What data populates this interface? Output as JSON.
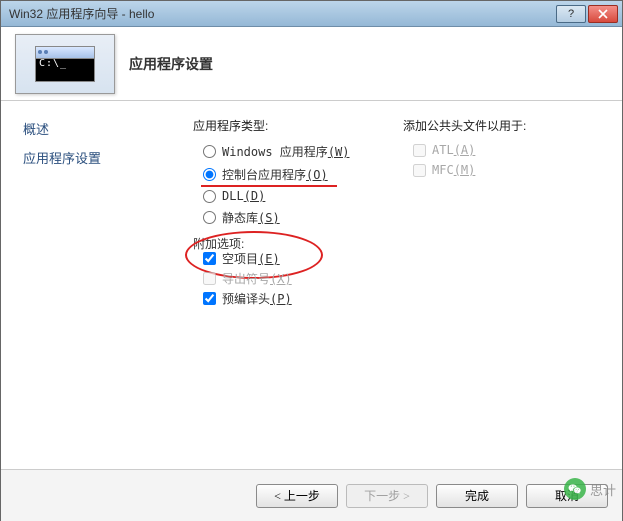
{
  "title": "Win32 应用程序向导 - hello",
  "header_title": "应用程序设置",
  "thumb_prompt": "C:\\_",
  "sidebar": {
    "items": [
      {
        "label": "概述"
      },
      {
        "label": "应用程序设置"
      }
    ]
  },
  "app_type": {
    "label": "应用程序类型:",
    "options": [
      {
        "text": "Windows 应用程序",
        "accel": "(W)",
        "checked": false
      },
      {
        "text": "控制台应用程序",
        "accel": "(O)",
        "checked": true
      },
      {
        "text": "DLL",
        "accel": "(D)",
        "checked": false
      },
      {
        "text": "静态库",
        "accel": "(S)",
        "checked": false
      }
    ]
  },
  "extra_opts": {
    "label": "附加选项:",
    "options": [
      {
        "text": "空项目",
        "accel": "(E)",
        "checked": true,
        "disabled": false
      },
      {
        "text": "导出符号",
        "accel": "(X)",
        "checked": false,
        "disabled": true
      },
      {
        "text": "预编译头",
        "accel": "(P)",
        "checked": true,
        "disabled": false
      }
    ]
  },
  "common_headers": {
    "label": "添加公共头文件以用于:",
    "options": [
      {
        "text": "ATL",
        "accel": "(A)",
        "checked": false,
        "disabled": true
      },
      {
        "text": "MFC",
        "accel": "(M)",
        "checked": false,
        "disabled": true
      }
    ]
  },
  "footer": {
    "prev": "< 上一步",
    "next": "下一步 >",
    "finish": "完成",
    "cancel": "取消"
  },
  "watermark": "思计"
}
